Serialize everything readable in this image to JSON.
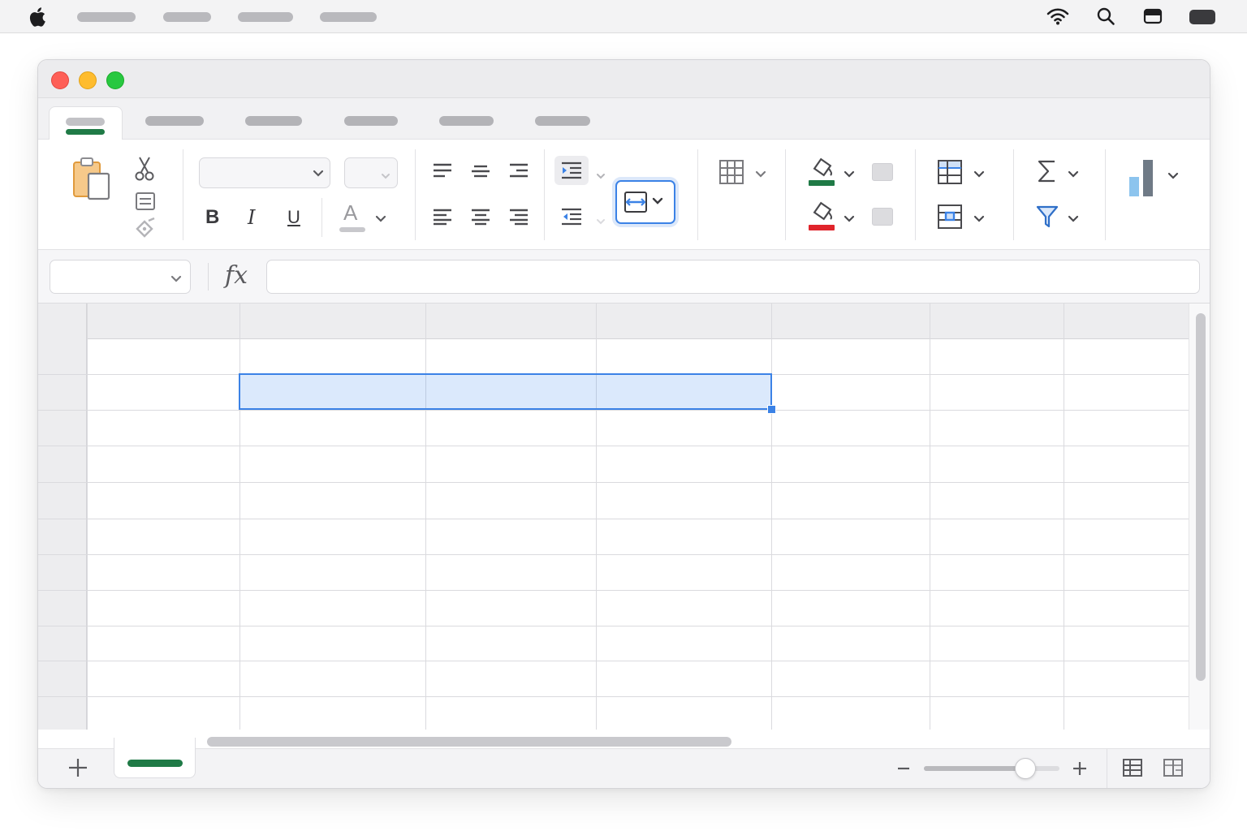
{
  "app": {
    "formula_symbol": "fx",
    "name_box_value": "",
    "formula_value": ""
  },
  "ribbon": {
    "bold_label": "B",
    "italic_label": "I",
    "underline_label": "U",
    "font_color_label": "A"
  },
  "colors": {
    "accent_green": "#1f7a46",
    "selection_blue": "#3b82e6",
    "fill_green": "#1f7a46",
    "font_red": "#e0242b"
  },
  "zoom": {
    "level_fraction": 0.75
  }
}
